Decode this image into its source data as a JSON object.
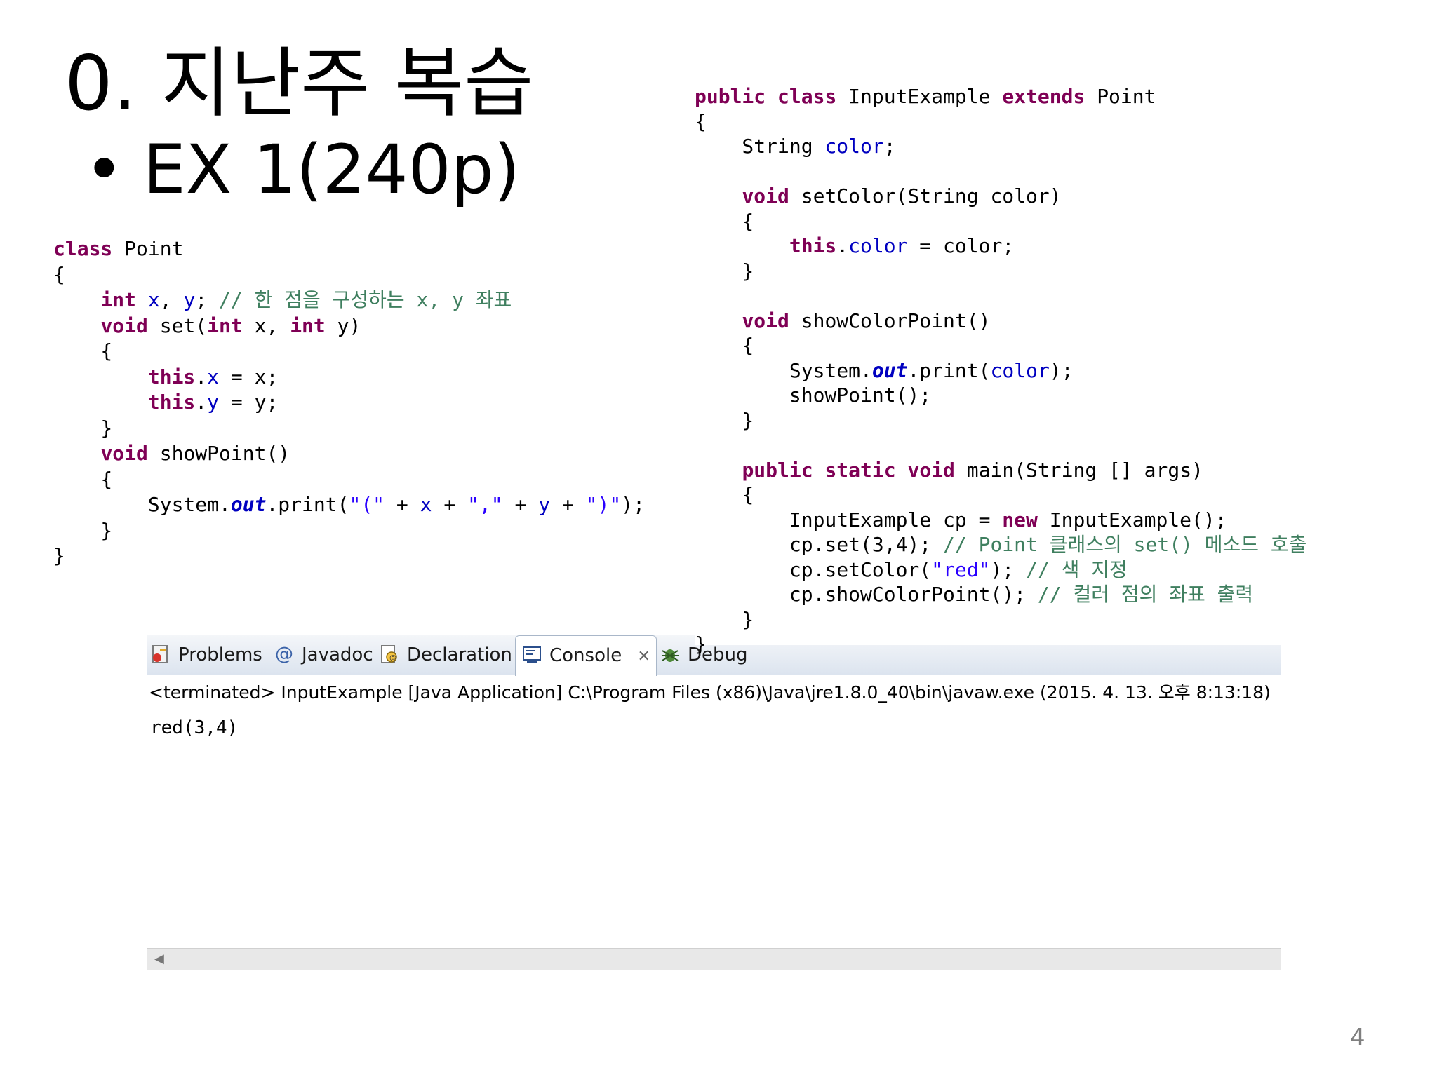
{
  "slide": {
    "title": "0. 지난주 복습",
    "bullet_symbol": "•",
    "bullet_text": "EX 1(240p)",
    "page_number": "4"
  },
  "code_left": {
    "lines": [
      [
        {
          "t": "class",
          "c": "kw"
        },
        {
          "t": " Point",
          "c": "pln"
        }
      ],
      [
        {
          "t": "{",
          "c": "pln"
        }
      ],
      [
        {
          "t": "    ",
          "c": "pln"
        },
        {
          "t": "int",
          "c": "kw"
        },
        {
          "t": " ",
          "c": "pln"
        },
        {
          "t": "x",
          "c": "fld"
        },
        {
          "t": ", ",
          "c": "pln"
        },
        {
          "t": "y",
          "c": "fld"
        },
        {
          "t": "; ",
          "c": "pln"
        },
        {
          "t": "// 한 점을 구성하는 x, y 좌표",
          "c": "cmt"
        }
      ],
      [
        {
          "t": "    ",
          "c": "pln"
        },
        {
          "t": "void",
          "c": "kw"
        },
        {
          "t": " set(",
          "c": "pln"
        },
        {
          "t": "int",
          "c": "kw"
        },
        {
          "t": " x, ",
          "c": "pln"
        },
        {
          "t": "int",
          "c": "kw"
        },
        {
          "t": " y)",
          "c": "pln"
        }
      ],
      [
        {
          "t": "    {",
          "c": "pln"
        }
      ],
      [
        {
          "t": "        ",
          "c": "pln"
        },
        {
          "t": "this",
          "c": "kw"
        },
        {
          "t": ".",
          "c": "pln"
        },
        {
          "t": "x",
          "c": "fld"
        },
        {
          "t": " = x;",
          "c": "pln"
        }
      ],
      [
        {
          "t": "        ",
          "c": "pln"
        },
        {
          "t": "this",
          "c": "kw"
        },
        {
          "t": ".",
          "c": "pln"
        },
        {
          "t": "y",
          "c": "fld"
        },
        {
          "t": " = y;",
          "c": "pln"
        }
      ],
      [
        {
          "t": "    }",
          "c": "pln"
        }
      ],
      [
        {
          "t": "    ",
          "c": "pln"
        },
        {
          "t": "void",
          "c": "kw"
        },
        {
          "t": " showPoint()",
          "c": "pln"
        }
      ],
      [
        {
          "t": "    {",
          "c": "pln"
        }
      ],
      [
        {
          "t": "        System.",
          "c": "pln"
        },
        {
          "t": "out",
          "c": "sfld"
        },
        {
          "t": ".print(",
          "c": "pln"
        },
        {
          "t": "\"(\"",
          "c": "str"
        },
        {
          "t": " + ",
          "c": "pln"
        },
        {
          "t": "x",
          "c": "fld"
        },
        {
          "t": " + ",
          "c": "pln"
        },
        {
          "t": "\",\"",
          "c": "str"
        },
        {
          "t": " + ",
          "c": "pln"
        },
        {
          "t": "y",
          "c": "fld"
        },
        {
          "t": " + ",
          "c": "pln"
        },
        {
          "t": "\")\"",
          "c": "str"
        },
        {
          "t": ");",
          "c": "pln"
        }
      ],
      [
        {
          "t": "    }",
          "c": "pln"
        }
      ],
      [
        {
          "t": "}",
          "c": "pln"
        }
      ]
    ]
  },
  "code_right": {
    "lines": [
      [
        {
          "t": "public",
          "c": "kw"
        },
        {
          "t": " ",
          "c": "pln"
        },
        {
          "t": "class",
          "c": "kw"
        },
        {
          "t": " InputExample ",
          "c": "pln"
        },
        {
          "t": "extends",
          "c": "kw"
        },
        {
          "t": " Point",
          "c": "pln"
        }
      ],
      [
        {
          "t": "{",
          "c": "pln"
        }
      ],
      [
        {
          "t": "    String ",
          "c": "pln"
        },
        {
          "t": "color",
          "c": "fld"
        },
        {
          "t": ";",
          "c": "pln"
        }
      ],
      [],
      [
        {
          "t": "    ",
          "c": "pln"
        },
        {
          "t": "void",
          "c": "kw"
        },
        {
          "t": " setColor(String color)",
          "c": "pln"
        }
      ],
      [
        {
          "t": "    {",
          "c": "pln"
        }
      ],
      [
        {
          "t": "        ",
          "c": "pln"
        },
        {
          "t": "this",
          "c": "kw"
        },
        {
          "t": ".",
          "c": "pln"
        },
        {
          "t": "color",
          "c": "fld"
        },
        {
          "t": " = color;",
          "c": "pln"
        }
      ],
      [
        {
          "t": "    }",
          "c": "pln"
        }
      ],
      [],
      [
        {
          "t": "    ",
          "c": "pln"
        },
        {
          "t": "void",
          "c": "kw"
        },
        {
          "t": " showColorPoint()",
          "c": "pln"
        }
      ],
      [
        {
          "t": "    {",
          "c": "pln"
        }
      ],
      [
        {
          "t": "        System.",
          "c": "pln"
        },
        {
          "t": "out",
          "c": "sfld"
        },
        {
          "t": ".print(",
          "c": "pln"
        },
        {
          "t": "color",
          "c": "fld"
        },
        {
          "t": ");",
          "c": "pln"
        }
      ],
      [
        {
          "t": "        showPoint();",
          "c": "pln"
        }
      ],
      [
        {
          "t": "    }",
          "c": "pln"
        }
      ],
      [],
      [
        {
          "t": "    ",
          "c": "pln"
        },
        {
          "t": "public",
          "c": "kw"
        },
        {
          "t": " ",
          "c": "pln"
        },
        {
          "t": "static",
          "c": "kw"
        },
        {
          "t": " ",
          "c": "pln"
        },
        {
          "t": "void",
          "c": "kw"
        },
        {
          "t": " main(String [] args)",
          "c": "pln"
        }
      ],
      [
        {
          "t": "    {",
          "c": "pln"
        }
      ],
      [
        {
          "t": "        InputExample cp = ",
          "c": "pln"
        },
        {
          "t": "new",
          "c": "kw"
        },
        {
          "t": " InputExample();",
          "c": "pln"
        }
      ],
      [
        {
          "t": "        cp.set(3,4); ",
          "c": "pln"
        },
        {
          "t": "// Point 클래스의 set() 메소드 호출",
          "c": "cmt"
        }
      ],
      [
        {
          "t": "        cp.setColor(",
          "c": "pln"
        },
        {
          "t": "\"red\"",
          "c": "str"
        },
        {
          "t": "); ",
          "c": "pln"
        },
        {
          "t": "// 색 지정",
          "c": "cmt"
        }
      ],
      [
        {
          "t": "        cp.showColorPoint(); ",
          "c": "pln"
        },
        {
          "t": "// 컬러 점의 좌표 출력",
          "c": "cmt"
        }
      ],
      [
        {
          "t": "    }",
          "c": "pln"
        }
      ],
      [
        {
          "t": "}",
          "c": "pln"
        }
      ]
    ]
  },
  "console": {
    "tabs": [
      {
        "label": "Problems",
        "icon": "problems-icon"
      },
      {
        "label": "Javadoc",
        "icon": "at-icon"
      },
      {
        "label": "Declaration",
        "icon": "declaration-icon"
      },
      {
        "label": "Console",
        "icon": "console-icon",
        "active": true
      },
      {
        "label": "Debug",
        "icon": "bug-icon"
      }
    ],
    "close_glyph": "✕",
    "path": "<terminated> InputExample [Java Application] C:\\Program Files (x86)\\Java\\jre1.8.0_40\\bin\\javaw.exe (2015. 4. 13. 오후 8:13:18)",
    "output": "red(3,4)",
    "scroll_left_glyph": "◀"
  },
  "colors": {
    "keyword": "#7f0055",
    "field": "#0000c0",
    "string": "#2a00ff",
    "comment": "#3f7f5f"
  }
}
